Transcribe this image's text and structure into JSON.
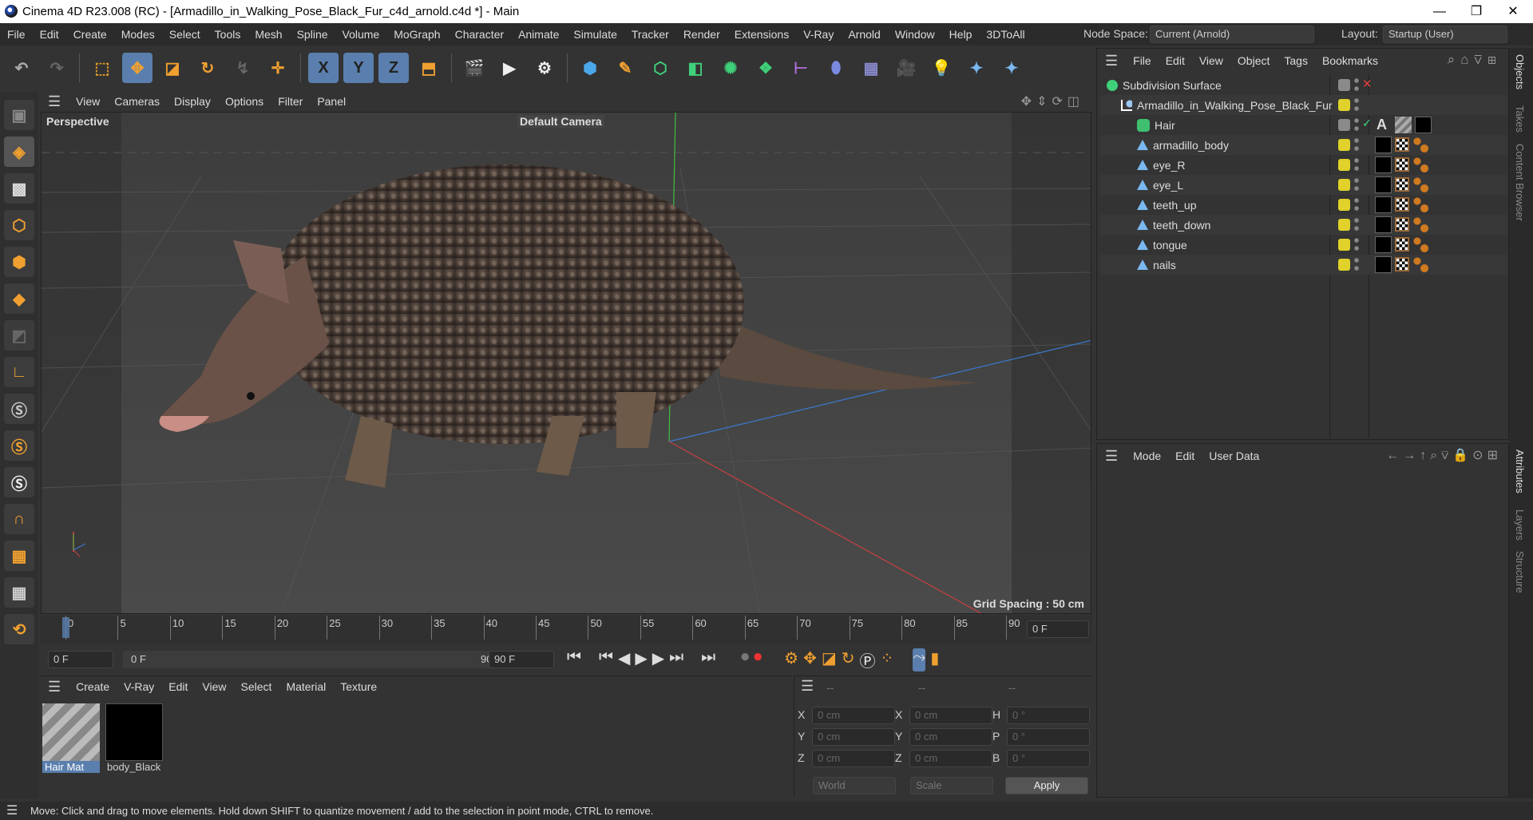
{
  "window": {
    "title": "Cinema 4D R23.008 (RC) - [Armadillo_in_Walking_Pose_Black_Fur_c4d_arnold.c4d *] - Main",
    "minimize": "—",
    "maximize": "❐",
    "close": "✕"
  },
  "menu": [
    "File",
    "Edit",
    "Create",
    "Modes",
    "Select",
    "Tools",
    "Mesh",
    "Spline",
    "Volume",
    "MoGraph",
    "Character",
    "Animate",
    "Simulate",
    "Tracker",
    "Render",
    "Extensions",
    "V-Ray",
    "Arnold",
    "Window",
    "Help",
    "3DToAll"
  ],
  "node_space": {
    "label": "Node Space:",
    "value": "Current (Arnold)"
  },
  "layout": {
    "label": "Layout:",
    "value": "Startup (User)"
  },
  "toolbar": {
    "x": "X",
    "y": "Y",
    "z": "Z"
  },
  "viewport": {
    "menu": [
      "View",
      "Cameras",
      "Display",
      "Options",
      "Filter",
      "Panel"
    ],
    "view_name": "Perspective",
    "camera": "Default Camera",
    "grid_spacing": "Grid Spacing : 50 cm"
  },
  "timeline": {
    "ticks": [
      "0",
      "5",
      "10",
      "15",
      "20",
      "25",
      "30",
      "35",
      "40",
      "45",
      "50",
      "55",
      "60",
      "65",
      "70",
      "75",
      "80",
      "85",
      "90"
    ],
    "current_frame": "0 F",
    "start": "0 F",
    "range_start": "0 F",
    "range_end": "90 F",
    "end": "90 F"
  },
  "materials": {
    "menu": [
      "Create",
      "V-Ray",
      "Edit",
      "View",
      "Select",
      "Material",
      "Texture"
    ],
    "items": [
      {
        "name": "Hair Mat"
      },
      {
        "name": "body_Black"
      }
    ]
  },
  "coords": {
    "headers": [
      "--",
      "--",
      "--"
    ],
    "rows": [
      [
        "X",
        "0 cm",
        "X",
        "0 cm",
        "H",
        "0 °"
      ],
      [
        "Y",
        "0 cm",
        "Y",
        "0 cm",
        "P",
        "0 °"
      ],
      [
        "Z",
        "0 cm",
        "Z",
        "0 cm",
        "B",
        "0 °"
      ]
    ],
    "world": "World",
    "scale": "Scale",
    "apply": "Apply"
  },
  "objects": {
    "menu": [
      "File",
      "Edit",
      "View",
      "Object",
      "Tags",
      "Bookmarks"
    ],
    "items": [
      {
        "name": "Subdivision Surface"
      },
      {
        "name": "Armadillo_in_Walking_Pose_Black_Fur"
      },
      {
        "name": "Hair"
      },
      {
        "name": "armadillo_body"
      },
      {
        "name": "eye_R"
      },
      {
        "name": "eye_L"
      },
      {
        "name": "teeth_up"
      },
      {
        "name": "teeth_down"
      },
      {
        "name": "tongue"
      },
      {
        "name": "nails"
      }
    ],
    "hair_tag_letter": "A"
  },
  "attributes": {
    "menu": [
      "Mode",
      "Edit",
      "User Data"
    ]
  },
  "right_tabs": [
    "Objects",
    "Takes",
    "Content Browser",
    "Attributes",
    "Layers",
    "Structure"
  ],
  "status": "Move: Click and drag to move elements. Hold down SHIFT to quantize movement / add to the selection in point mode, CTRL to remove."
}
